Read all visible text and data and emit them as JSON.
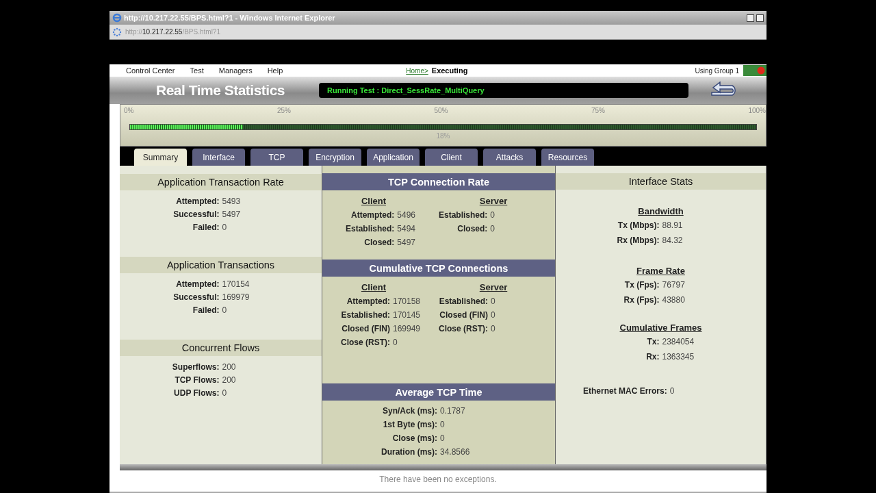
{
  "window": {
    "title": "http://10.217.22.55/BPS.html?1 - Windows Internet Explorer"
  },
  "address": {
    "prefix": "http://",
    "host": "10.217.22.55",
    "path": "/BPS.html?1"
  },
  "menu": [
    "Control Center",
    "Test",
    "Managers",
    "Help"
  ],
  "breadcrumb": {
    "link": "Home>",
    "current": "Executing"
  },
  "group": "Using Group 1",
  "header": {
    "title": "Real Time Statistics",
    "running_test": "Running Test : Direct_SessRate_MultiQuery"
  },
  "progress": {
    "ticks": [
      "0%",
      "25%",
      "50%",
      "75%",
      "100%"
    ],
    "level": 0.18,
    "reading": "18%"
  },
  "tabs": [
    {
      "label": "Summary",
      "selected": true
    },
    {
      "label": "Interface",
      "selected": false
    },
    {
      "label": "TCP",
      "selected": false
    },
    {
      "label": "Encryption",
      "selected": false
    },
    {
      "label": "Application",
      "selected": false
    },
    {
      "label": "Client",
      "selected": false
    },
    {
      "label": "Attacks",
      "selected": false
    },
    {
      "label": "Resources",
      "selected": false
    }
  ],
  "left_sections": [
    {
      "title": "Application Transaction Rate",
      "rows": [
        [
          "Attempted:",
          "5493"
        ],
        [
          "Successful:",
          "5497"
        ],
        [
          "Failed:",
          "0"
        ]
      ]
    },
    {
      "title": "Application Transactions",
      "rows": [
        [
          "Attempted:",
          "170154"
        ],
        [
          "Successful:",
          "169979"
        ],
        [
          "Failed:",
          "0"
        ]
      ]
    },
    {
      "title": "Concurrent Flows",
      "rows": [
        [
          "Superflows:",
          "200"
        ],
        [
          "TCP Flows:",
          "200"
        ],
        [
          "UDP Flows:",
          "0"
        ]
      ]
    }
  ],
  "middle_sections": [
    {
      "kind": "split",
      "title": "TCP Connection Rate",
      "client": {
        "heading": "Client",
        "rows": [
          [
            "Attempted:",
            "5496"
          ],
          [
            "Established:",
            "5494"
          ],
          [
            "Closed:",
            "5497"
          ]
        ]
      },
      "server": {
        "heading": "Server",
        "rows": [
          [
            "Established:",
            "0"
          ],
          [
            "Closed:",
            "0"
          ]
        ]
      }
    },
    {
      "kind": "split",
      "title": "Cumulative TCP Connections",
      "client": {
        "heading": "Client",
        "rows": [
          [
            "Attempted:",
            "170158"
          ],
          [
            "Established:",
            "170145"
          ],
          [
            "Closed (FIN)",
            "169949"
          ],
          [
            "Close (RST):",
            "0"
          ]
        ]
      },
      "server": {
        "heading": "Server",
        "rows": [
          [
            "Established:",
            "0"
          ],
          [
            "Closed (FIN)",
            "0"
          ],
          [
            "Close (RST):",
            "0"
          ]
        ]
      }
    },
    {
      "kind": "single",
      "title": "Average TCP Time",
      "rows": [
        [
          "Syn/Ack (ms):",
          "0.1787"
        ],
        [
          "1st Byte (ms):",
          "0"
        ],
        [
          "Close (ms):",
          "0"
        ],
        [
          "Duration (ms):",
          "34.8566"
        ]
      ]
    }
  ],
  "interface_stats": {
    "title": "Interface Stats",
    "groups": [
      {
        "heading": "Bandwidth",
        "rows": [
          [
            "Tx (Mbps):",
            "88.91"
          ],
          [
            "Rx (Mbps):",
            "84.32"
          ]
        ]
      },
      {
        "heading": "Frame Rate",
        "rows": [
          [
            "Tx (Fps):",
            "76797"
          ],
          [
            "Rx (Fps):",
            "43880"
          ]
        ]
      },
      {
        "heading": "Cumulative Frames",
        "rows": [
          [
            "Tx:",
            "2384054"
          ],
          [
            "Rx:",
            "1363345"
          ]
        ]
      }
    ],
    "mac_errors": [
      "Ethernet MAC Errors:",
      "0"
    ]
  },
  "status_bar": "There have been no exceptions."
}
